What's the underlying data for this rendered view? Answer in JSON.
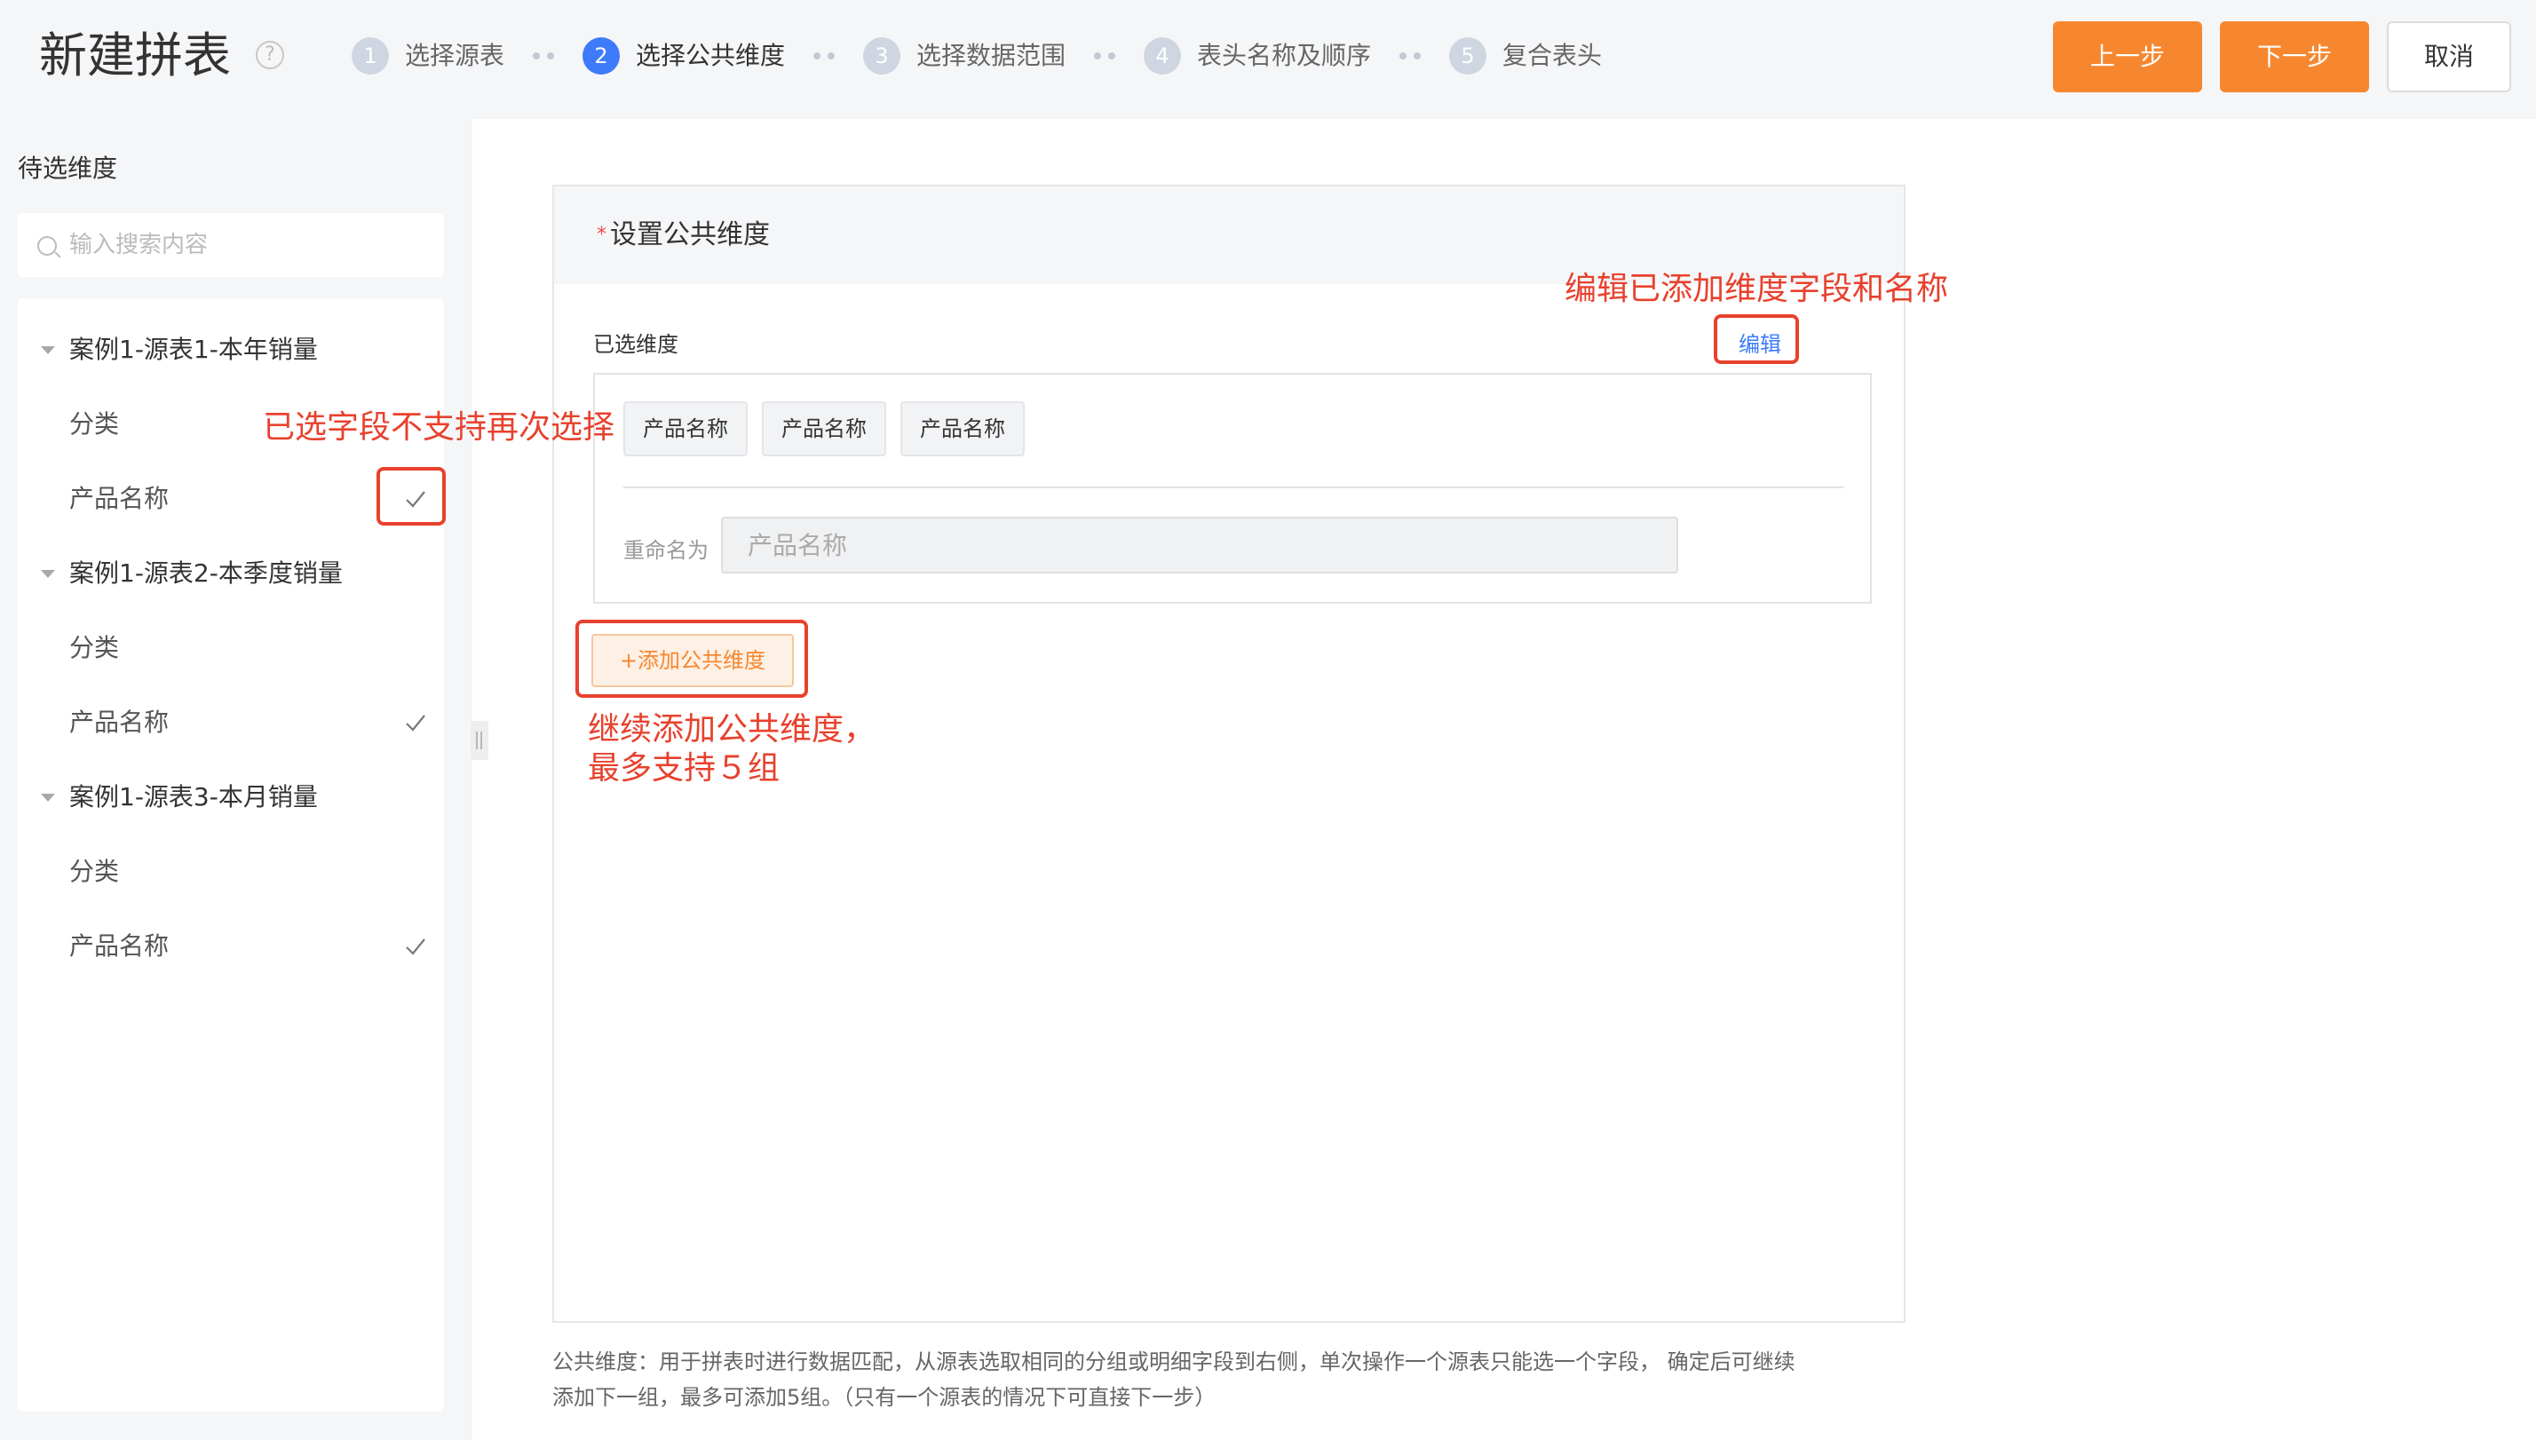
{
  "header": {
    "title": "新建拼表",
    "help_icon": "?",
    "steps": [
      {
        "num": "1",
        "label": "选择源表",
        "active": false
      },
      {
        "num": "2",
        "label": "选择公共维度",
        "active": true
      },
      {
        "num": "3",
        "label": "选择数据范围",
        "active": false
      },
      {
        "num": "4",
        "label": "表头名称及顺序",
        "active": false
      },
      {
        "num": "5",
        "label": "复合表头",
        "active": false
      }
    ],
    "prev_label": "上一步",
    "next_label": "下一步",
    "cancel_label": "取消",
    "accent_color": "#f7872f"
  },
  "left_panel": {
    "title": "待选维度",
    "search_placeholder": "输入搜索内容",
    "groups": [
      {
        "label": "案例1-源表1-本年销量",
        "items": [
          {
            "label": "分类",
            "checked": false
          },
          {
            "label": "产品名称",
            "checked": true
          }
        ]
      },
      {
        "label": "案例1-源表2-本季度销量",
        "items": [
          {
            "label": "分类",
            "checked": false
          },
          {
            "label": "产品名称",
            "checked": true
          }
        ]
      },
      {
        "label": "案例1-源表3-本月销量",
        "items": [
          {
            "label": "分类",
            "checked": false
          },
          {
            "label": "产品名称",
            "checked": true
          }
        ]
      }
    ]
  },
  "main": {
    "section_title": "设置公共维度",
    "required_mark": "*",
    "selected_label": "已选维度",
    "edit_label": "编辑",
    "tags": [
      "产品名称",
      "产品名称",
      "产品名称"
    ],
    "rename_label": "重命名为",
    "rename_placeholder": "产品名称",
    "add_button_label": "+添加公共维度",
    "footnote_line1": "公共维度：用于拼表时进行数据匹配，从源表选取相同的分组或明细字段到右侧，单次操作一个源表只能选一个字段， 确定后可继续",
    "footnote_line2": "添加下一组，最多可添加5组。（只有一个源表的情况下可直接下一步）"
  },
  "annotations": {
    "edit_note": "编辑已添加维度字段和名称",
    "selected_note": "已选字段不支持再次选择",
    "add_note_line1": "继续添加公共维度，",
    "add_note_line2": "最多支持５组",
    "color": "#e8412d"
  }
}
